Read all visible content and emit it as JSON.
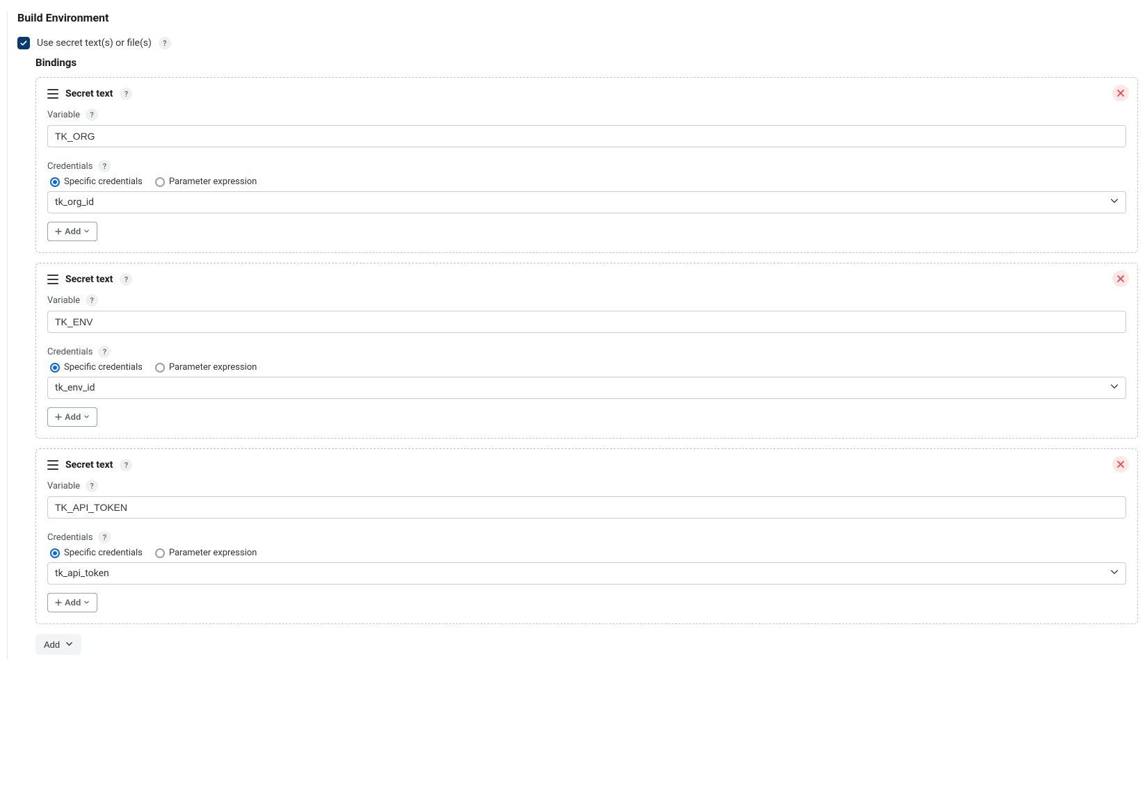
{
  "section_title": "Build Environment",
  "use_secrets": {
    "label": "Use secret text(s) or file(s)",
    "checked": true
  },
  "bindings_title": "Bindings",
  "binding_type_label": "Secret text",
  "variable_label": "Variable",
  "credentials_label": "Credentials",
  "radio_options": {
    "specific": "Specific credentials",
    "parameter": "Parameter expression"
  },
  "add_small_label": "Add",
  "add_bottom_label": "Add",
  "help_glyph": "?",
  "bindings": [
    {
      "variable_value": "TK_ORG",
      "credentials_mode": "specific",
      "credentials_value": "tk_org_id"
    },
    {
      "variable_value": "TK_ENV",
      "credentials_mode": "specific",
      "credentials_value": "tk_env_id"
    },
    {
      "variable_value": "TK_API_TOKEN",
      "credentials_mode": "specific",
      "credentials_value": "tk_api_token"
    }
  ]
}
